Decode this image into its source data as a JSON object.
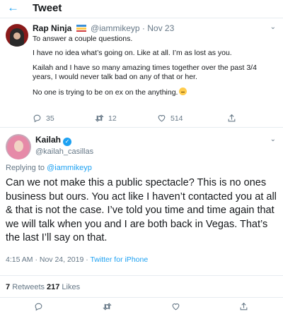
{
  "header": {
    "back_icon": "back-arrow-icon",
    "title": "Tweet"
  },
  "parent_tweet": {
    "author_name": "Rap Ninja",
    "handle": "@iammikeyp",
    "separator": "·",
    "date": "Nov 23",
    "lines": [
      "To answer a couple questions.",
      "I have no idea what’s going on. Like at all. I’m as lost as you.",
      "Kailah and I have so many amazing times together over the past 3/4 years, I would never talk bad on any of that or her.",
      "No one is trying to be on ex on the anything."
    ],
    "replies": "35",
    "retweets": "12",
    "likes": "514"
  },
  "main_tweet": {
    "author_name": "Kailah",
    "handle": "@kailah_casillas",
    "replying_prefix": "Replying to",
    "replying_to": "@iammikeyp",
    "text": "Can we not make this a public spectacle? This is no ones business but ours. You act like I haven’t contacted you at all & that is not the case. I’ve told you time and time again that we will talk when you and I are both back in Vegas. That’s the last I’ll say on that.",
    "timestamp": "4:15 AM · Nov 24, 2019 · ",
    "source": "Twitter for iPhone",
    "retweets_count": "7",
    "retweets_label": "Retweets",
    "likes_count": "217",
    "likes_label": "Likes"
  },
  "colors": {
    "accent": "#1da1f2",
    "secondary_text": "#657786",
    "border": "#e6ecf0"
  }
}
